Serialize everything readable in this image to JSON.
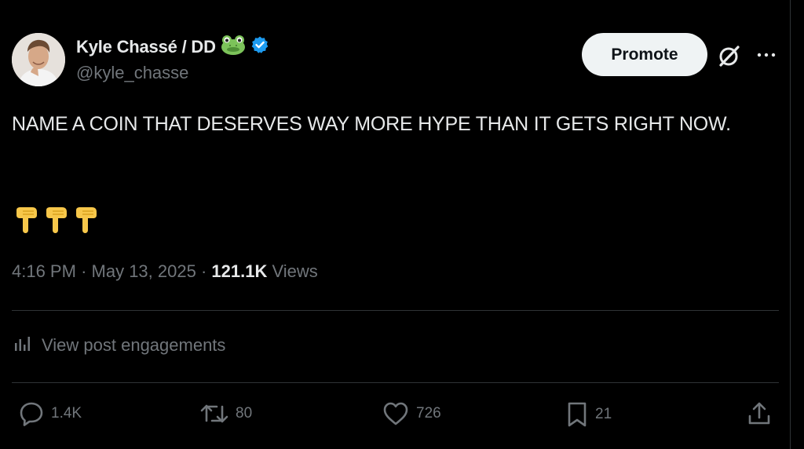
{
  "author": {
    "display_name": "Kyle Chassé / DD",
    "display_emoji": "frog-emoji",
    "verified": "verified-badge-icon",
    "handle": "@kyle_chasse"
  },
  "header_actions": {
    "promote_label": "Promote",
    "grok_icon": "grok-icon",
    "more_icon": "more-options-icon"
  },
  "tweet": {
    "text": "NAME A COIN THAT DESERVES WAY MORE HYPE THAN IT GETS RIGHT NOW.",
    "emojis": [
      "backhand-index-pointing-down-emoji",
      "backhand-index-pointing-down-emoji",
      "backhand-index-pointing-down-emoji"
    ]
  },
  "meta": {
    "time": "4:16 PM",
    "date": "May 13, 2025",
    "separator": "·",
    "views_count": "121.1K",
    "views_label": "Views"
  },
  "engagements": {
    "label": "View post engagements",
    "icon": "analytics-icon"
  },
  "actions": {
    "replies": "1.4K",
    "reposts": "80",
    "likes": "726",
    "bookmarks": "21"
  },
  "colors": {
    "background": "#000000",
    "primary_text": "#e7e9ea",
    "secondary_text": "#71767b",
    "divider": "#2f3336",
    "verified_blue": "#1d9bf0",
    "promote_bg": "#eff3f4"
  }
}
